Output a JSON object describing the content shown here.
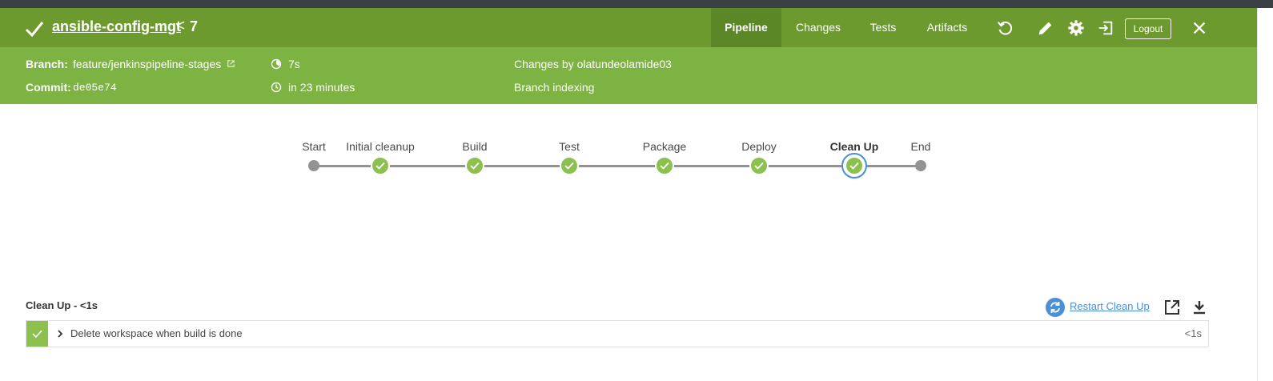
{
  "header": {
    "title": "ansible-config-mgt",
    "separator": "<",
    "run_number": "7",
    "tabs": [
      {
        "label": "Pipeline",
        "active": true
      },
      {
        "label": "Changes",
        "active": false
      },
      {
        "label": "Tests",
        "active": false
      },
      {
        "label": "Artifacts",
        "active": false
      }
    ],
    "icons": [
      "replay-icon",
      "edit-icon",
      "gear-icon",
      "exit-icon",
      "close-icon"
    ],
    "logout_label": "Logout"
  },
  "run_info": {
    "branch_label": "Branch:",
    "branch_value": "feature/jenkinspipeline-stages",
    "commit_label": "Commit:",
    "commit_value": "de05e74",
    "duration": "7s",
    "started": "in 23 minutes",
    "changes_by": "Changes by olatundeolamide03",
    "cause": "Branch indexing"
  },
  "pipeline": {
    "stages": [
      {
        "label": "Start",
        "kind": "start"
      },
      {
        "label": "Initial cleanup",
        "kind": "success"
      },
      {
        "label": "Build",
        "kind": "success"
      },
      {
        "label": "Test",
        "kind": "success"
      },
      {
        "label": "Package",
        "kind": "success"
      },
      {
        "label": "Deploy",
        "kind": "success"
      },
      {
        "label": "Clean Up",
        "kind": "success",
        "selected": true
      },
      {
        "label": "End",
        "kind": "end"
      }
    ]
  },
  "step_panel": {
    "title": "Clean Up - <1s",
    "restart_label": "Restart Clean Up",
    "steps": [
      {
        "label": "Delete workspace when build is done",
        "duration": "<1s",
        "status": "success"
      }
    ]
  },
  "colors": {
    "header_bg": "#6d9a2e",
    "subheader_bg": "#7cb342",
    "success": "#8cc04f",
    "link": "#4a90d9",
    "connector": "#949393"
  }
}
